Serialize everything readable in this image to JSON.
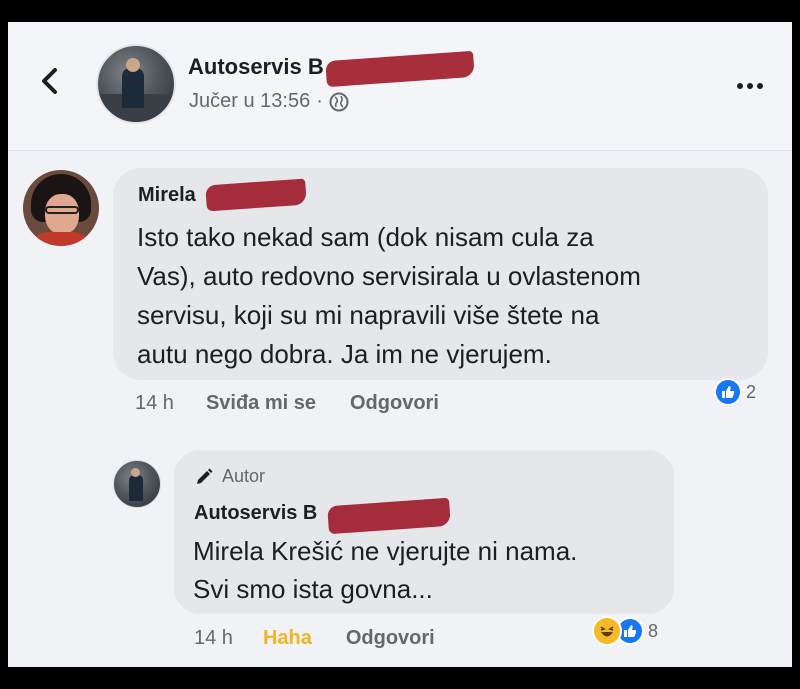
{
  "header": {
    "page_name": "Autoservis B",
    "post_time": "Jučer u 13:56",
    "separator": "·",
    "icons": {
      "back": "chevron-left-icon",
      "privacy": "globe-icon",
      "more": "more-dots-icon"
    }
  },
  "comment": {
    "author": "Mirela",
    "text": "Isto tako nekad sam (dok nisam cula za\nVas), auto redovno servisirala u ovlastenom\nservisu, koji su mi napravili više štete na\nautu nego dobra. Ja im ne vjerujem.",
    "time": "14 h",
    "like_label": "Sviđa mi se",
    "reply_label": "Odgovori",
    "reaction_count": "2",
    "reaction_icon": "like-icon"
  },
  "reply": {
    "badge": "Autor",
    "author": "Autoservis B",
    "text": "Mirela Krešić ne vjerujte ni nama.\nSvi smo ista govna...",
    "time": "14 h",
    "reaction_label": "Haha",
    "reply_label": "Odgovori",
    "reaction_count": "8",
    "reaction_icons": [
      "haha-icon",
      "like-icon"
    ]
  },
  "colors": {
    "background": "#f1f2f6",
    "bubble": "#e6e7eb",
    "text": "#1c1e21",
    "muted": "#65676b",
    "like_blue": "#1877f2",
    "haha_yellow": "#f0b429",
    "redaction": "#a01c2a"
  }
}
